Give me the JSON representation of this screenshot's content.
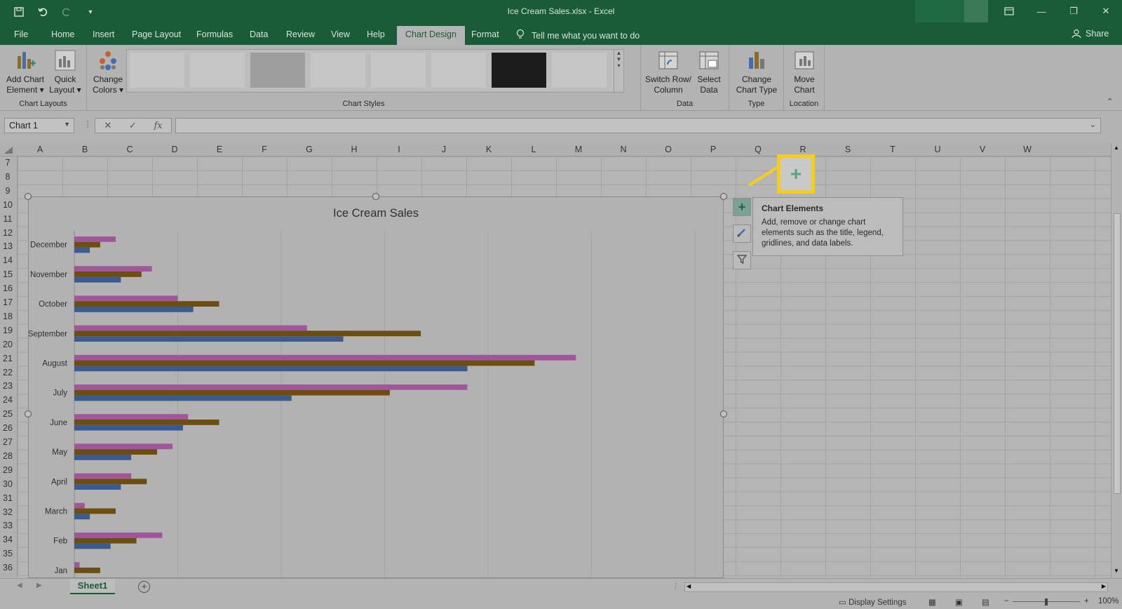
{
  "window": {
    "title": "Ice Cream Sales.xlsx  -  Excel"
  },
  "menu": {
    "tabs": [
      {
        "label": "File"
      },
      {
        "label": "Home"
      },
      {
        "label": "Insert"
      },
      {
        "label": "Page Layout"
      },
      {
        "label": "Formulas"
      },
      {
        "label": "Data"
      },
      {
        "label": "Review"
      },
      {
        "label": "View"
      },
      {
        "label": "Help"
      },
      {
        "label": "Chart Design"
      },
      {
        "label": "Format"
      }
    ],
    "tell_me": "Tell me what you want to do",
    "share": "Share"
  },
  "ribbon": {
    "chart_layouts": {
      "label": "Chart Layouts",
      "add_chart_element": "Add Chart Element",
      "quick_layout": "Quick Layout"
    },
    "chart_styles": {
      "label": "Chart Styles",
      "change_colors": "Change Colors"
    },
    "data": {
      "label": "Data",
      "switch_row_column": "Switch Row/ Column",
      "select_data": "Select Data"
    },
    "type": {
      "label": "Type",
      "change_chart_type": "Change Chart Type"
    },
    "location": {
      "label": "Location",
      "move_chart": "Move Chart"
    }
  },
  "formula_bar": {
    "name_box": "Chart 1",
    "fx": "fx",
    "formula": ""
  },
  "columns": [
    "A",
    "B",
    "C",
    "D",
    "E",
    "F",
    "G",
    "H",
    "I",
    "J",
    "K",
    "L",
    "M",
    "N",
    "O",
    "P",
    "Q",
    "R",
    "S",
    "T",
    "U",
    "V",
    "W"
  ],
  "rows": [
    "7",
    "8",
    "9",
    "10",
    "11",
    "12",
    "13",
    "14",
    "15",
    "16",
    "17",
    "18",
    "19",
    "20",
    "21",
    "22",
    "23",
    "24",
    "25",
    "26",
    "27",
    "28",
    "29",
    "30",
    "31",
    "32",
    "33",
    "34",
    "35",
    "36"
  ],
  "tooltip": {
    "title": "Chart Elements",
    "body": "Add, remove or change chart elements such as the title, legend, gridlines, and data labels."
  },
  "side_buttons": [
    "plus-icon",
    "brush-icon",
    "filter-icon"
  ],
  "colors": {
    "excel_green": "#1a5c37",
    "series_pink": "#a0569b",
    "series_brown": "#6b4e10",
    "series_blue": "#3b5a90",
    "highlight": "#f3cf1c"
  },
  "sheet_tabs": [
    "Sheet1"
  ],
  "status": {
    "display_settings": "Display Settings",
    "zoom": "100%"
  },
  "chart_data": {
    "type": "bar",
    "orientation": "horizontal",
    "title": "Ice Cream Sales",
    "categories": [
      "December",
      "November",
      "October",
      "September",
      "August",
      "July",
      "June",
      "May",
      "April",
      "March",
      "Feb",
      "Jan"
    ],
    "series": [
      {
        "color": "#a0569b",
        "values": [
          8,
          15,
          20,
          45,
          97,
          76,
          22,
          19,
          11,
          2,
          17,
          1
        ]
      },
      {
        "color": "#6b4e10",
        "values": [
          5,
          13,
          28,
          67,
          89,
          61,
          28,
          16,
          14,
          8,
          12,
          5
        ]
      },
      {
        "color": "#3b5a90",
        "values": [
          3,
          9,
          23,
          52,
          76,
          42,
          21,
          11,
          9,
          3,
          7,
          0
        ]
      }
    ],
    "xlim": [
      0,
      120
    ],
    "grid": "vertical"
  }
}
